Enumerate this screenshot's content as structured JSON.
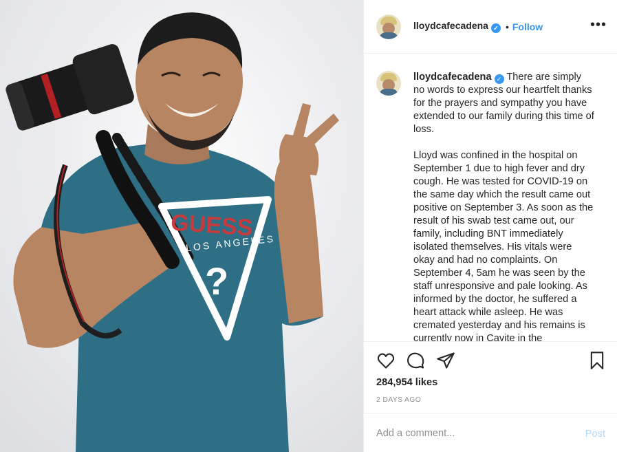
{
  "post": {
    "image_alt": "Photo of a smiling man in a teal GUESS Los Angeles shirt holding a camera on a tripod and making a peace sign",
    "shirt_brand": "GUESS",
    "shirt_city": "LOS ANGELES",
    "shirt_mark": "?"
  },
  "header": {
    "username": "lloydcafecadena",
    "verified_glyph": "✓",
    "separator": "•",
    "follow_label": "Follow",
    "more_label": "•••"
  },
  "caption": {
    "username": "lloydcafecadena",
    "text": " There are simply no words to express our heartfelt thanks for the prayers and sympathy you have extended to our family during this time of loss.\n\nLloyd was confined in the hospital on September 1 due to high fever and dry cough. He was tested for COVID-19 on the same day which the result came out positive on September 3. As soon as the result of his swab test came out, our family, including BNT immediately isolated themselves. His vitals were okay and had no complaints. On September 4, 5am he was seen by the staff unresponsive and pale looking. As informed by the doctor, he suffered a heart attack while asleep. He was cremated yesterday and his remains is currently now in Cavite in the"
  },
  "actions": {
    "icons": [
      "heart-icon",
      "comment-icon",
      "share-icon",
      "bookmark-icon"
    ]
  },
  "stats": {
    "likes": "284,954 likes",
    "date": "2 DAYS AGO"
  },
  "comment": {
    "placeholder": "Add a comment...",
    "post_label": "Post"
  },
  "colors": {
    "accent": "#3897f0",
    "post_disabled": "#b3dbff",
    "shirt": "#2f6f86",
    "text": "#262626",
    "muted": "#8e8e8e"
  }
}
